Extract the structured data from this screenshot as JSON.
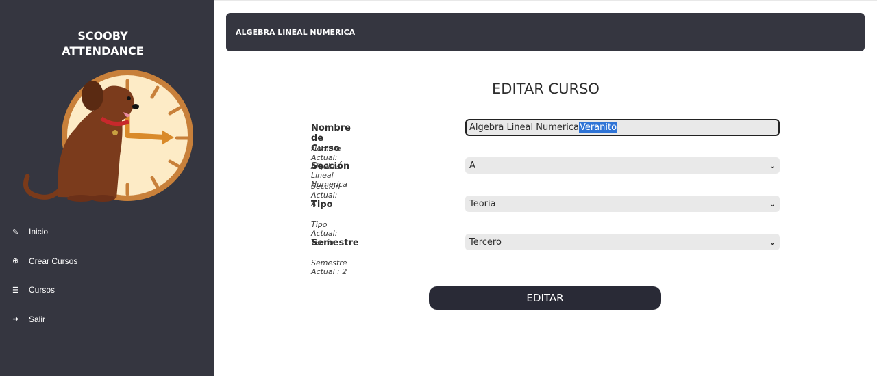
{
  "sidebar": {
    "brand_line1": "SCOOBY",
    "brand_line2": "ATTENDANCE",
    "items": [
      {
        "label": "Inicio",
        "icon": "edit-icon"
      },
      {
        "label": "Crear Cursos",
        "icon": "plus-circle-icon"
      },
      {
        "label": "Cursos",
        "icon": "list-icon"
      },
      {
        "label": "Salir",
        "icon": "sign-out-icon"
      }
    ]
  },
  "header": {
    "title": "ALGEBRA LINEAL NUMERICA"
  },
  "form": {
    "title": "EDITAR CURSO",
    "nombre_label": "Nombre de Curso",
    "nombre_value": "Algebra Lineal Numerica",
    "nombre_selected": "Veranito",
    "nombre_hint": "Nombre Actual: Algebra Lineal Numerica",
    "seccion_label": "Sección",
    "seccion_value": "A",
    "seccion_hint": "Sección Actual: A",
    "tipo_label": "Tipo",
    "tipo_value": "Teoria",
    "tipo_hint": "Tipo Actual: Teoria",
    "semestre_label": "Semestre",
    "semestre_value": "Tercero",
    "semestre_hint": "Semestre Actual : 2",
    "submit_label": "EDITAR"
  },
  "colors": {
    "sidebar": "#353640",
    "button": "#292a36",
    "field": "#e9e9e9",
    "selection": "#2f74d6"
  }
}
